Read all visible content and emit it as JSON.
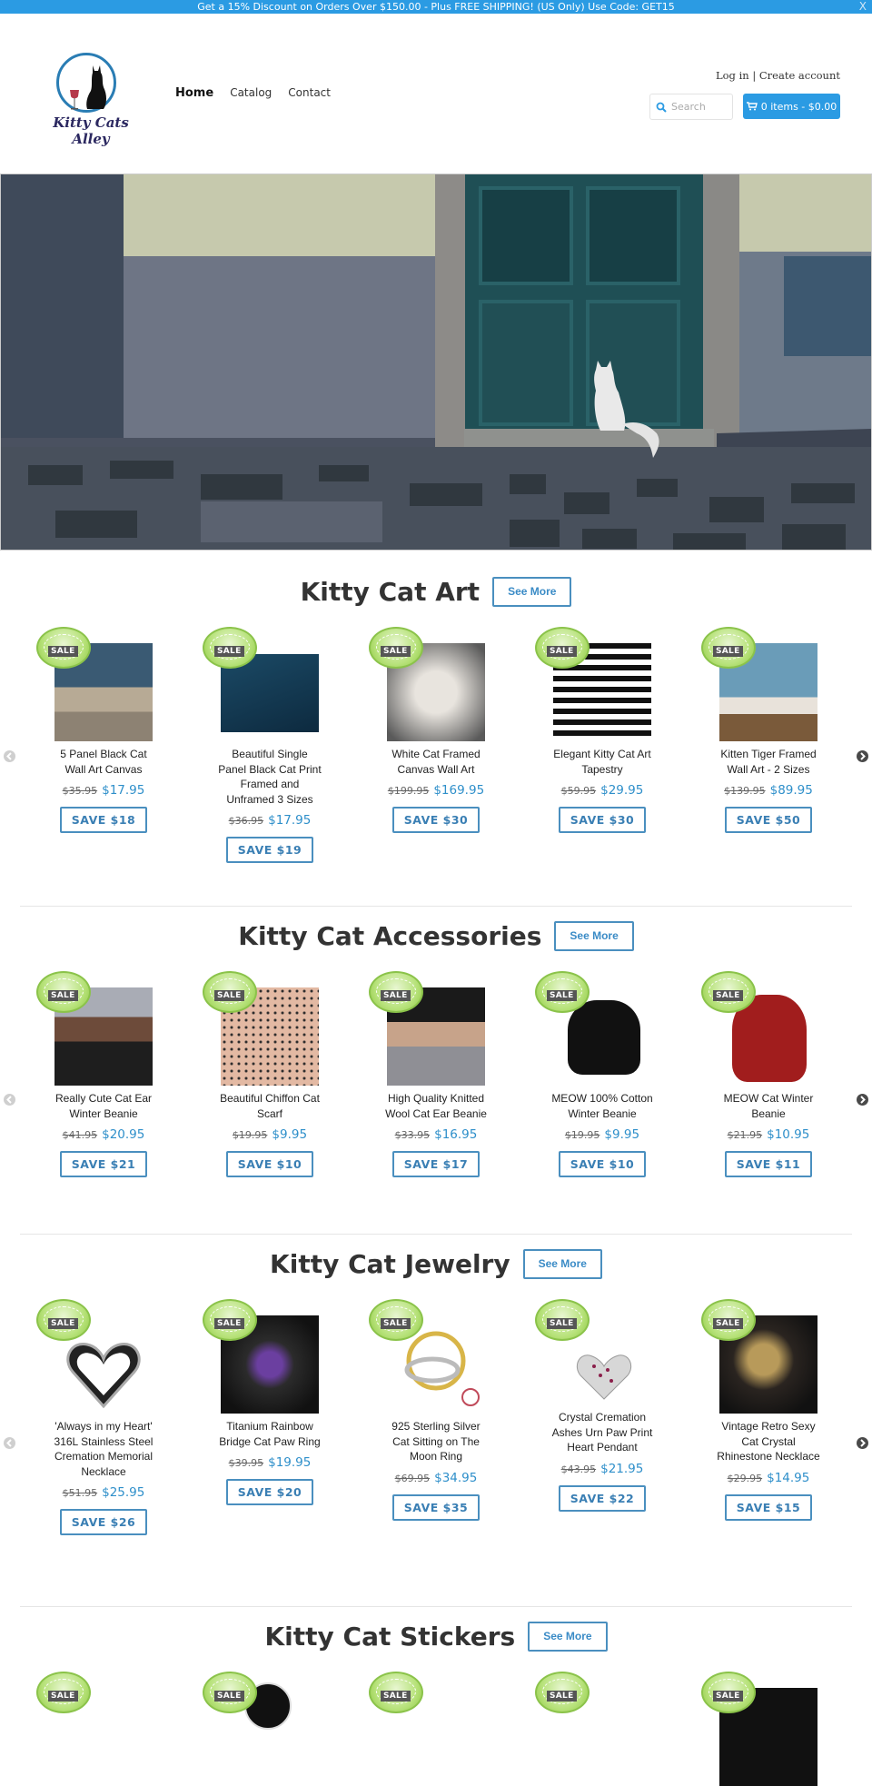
{
  "announcement": {
    "text": "Get a 15% Discount on Orders Over $150.00 - Plus FREE SHIPPING! (US Only) Use Code: GET15",
    "close": "X"
  },
  "brand": {
    "name": "Kitty Cats Alley"
  },
  "nav": {
    "items": [
      "Home",
      "Catalog",
      "Contact"
    ],
    "active": "Home"
  },
  "account": {
    "login": "Log in",
    "separator": " | ",
    "create": "Create account"
  },
  "search": {
    "placeholder": "Search",
    "value": ""
  },
  "cart": {
    "label": "0 items - $0.00"
  },
  "colors": {
    "accent": "#2b9be3",
    "price": "#2e8fca",
    "save_border": "#4a8fbf",
    "sale_badge": "#8cc63f"
  },
  "sections": [
    {
      "title": "Kitty Cat Art",
      "see_more": "See More",
      "products": [
        {
          "title": "5 Panel Black Cat Wall Art Canvas",
          "old_price": "$35.95",
          "price": "$17.95",
          "save": "SAVE $18",
          "badge": "SALE"
        },
        {
          "title": "Beautiful Single Panel Black Cat Print Framed and Unframed 3 Sizes",
          "old_price": "$36.95",
          "price": "$17.95",
          "save": "SAVE $19",
          "badge": "SALE"
        },
        {
          "title": "White Cat Framed Canvas Wall Art",
          "old_price": "$199.95",
          "price": "$169.95",
          "save": "SAVE $30",
          "badge": "SALE"
        },
        {
          "title": "Elegant Kitty Cat Art Tapestry",
          "old_price": "$59.95",
          "price": "$29.95",
          "save": "SAVE $30",
          "badge": "SALE"
        },
        {
          "title": "Kitten Tiger Framed Wall Art - 2 Sizes",
          "old_price": "$139.95",
          "price": "$89.95",
          "save": "SAVE $50",
          "badge": "SALE"
        }
      ]
    },
    {
      "title": "Kitty Cat Accessories",
      "see_more": "See More",
      "products": [
        {
          "title": "Really Cute Cat Ear Winter Beanie",
          "old_price": "$41.95",
          "price": "$20.95",
          "save": "SAVE $21",
          "badge": "SALE"
        },
        {
          "title": "Beautiful Chiffon Cat Scarf",
          "old_price": "$19.95",
          "price": "$9.95",
          "save": "SAVE $10",
          "badge": "SALE"
        },
        {
          "title": "High Quality Knitted Wool Cat Ear Beanie",
          "old_price": "$33.95",
          "price": "$16.95",
          "save": "SAVE $17",
          "badge": "SALE"
        },
        {
          "title": "MEOW 100% Cotton Winter Beanie",
          "old_price": "$19.95",
          "price": "$9.95",
          "save": "SAVE $10",
          "badge": "SALE"
        },
        {
          "title": "MEOW Cat Winter Beanie",
          "old_price": "$21.95",
          "price": "$10.95",
          "save": "SAVE $11",
          "badge": "SALE"
        }
      ]
    },
    {
      "title": "Kitty Cat Jewelry",
      "see_more": "See More",
      "products": [
        {
          "title": "'Always in my Heart' 316L Stainless Steel Cremation Memorial Necklace",
          "old_price": "$51.95",
          "price": "$25.95",
          "save": "SAVE $26",
          "badge": "SALE"
        },
        {
          "title": "Titanium Rainbow Bridge Cat Paw Ring",
          "old_price": "$39.95",
          "price": "$19.95",
          "save": "SAVE $20",
          "badge": "SALE"
        },
        {
          "title": "925 Sterling Silver Cat Sitting on The Moon Ring",
          "old_price": "$69.95",
          "price": "$34.95",
          "save": "SAVE $35",
          "badge": "SALE"
        },
        {
          "title": "Crystal Cremation Ashes Urn Paw Print Heart Pendant",
          "old_price": "$43.95",
          "price": "$21.95",
          "save": "SAVE $22",
          "badge": "SALE"
        },
        {
          "title": "Vintage Retro Sexy Cat Crystal Rhinestone Necklace",
          "old_price": "$29.95",
          "price": "$14.95",
          "save": "SAVE $15",
          "badge": "SALE"
        }
      ]
    },
    {
      "title": "Kitty Cat Stickers",
      "see_more": "See More",
      "products": [
        {
          "badge": "SALE"
        },
        {
          "badge": "SALE"
        },
        {
          "badge": "SALE"
        },
        {
          "badge": "SALE"
        },
        {
          "badge": "SALE"
        }
      ]
    }
  ]
}
